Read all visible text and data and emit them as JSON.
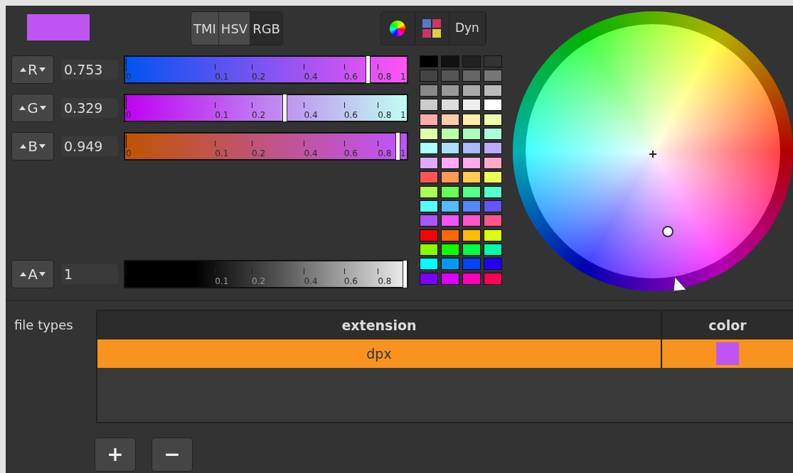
{
  "modes": [
    {
      "label": "TMI",
      "selected": false
    },
    {
      "label": "HSV",
      "selected": false
    },
    {
      "label": "RGB",
      "selected": true
    }
  ],
  "views": [
    {
      "kind": "wheel"
    },
    {
      "kind": "palette"
    },
    {
      "kind": "text",
      "label": "Dyn"
    }
  ],
  "channels": [
    {
      "kind": "color",
      "name": "R",
      "value": "0.753",
      "level": 0.868,
      "ticks": [
        "0",
        "0.1",
        "0.2",
        "0.4",
        "0.6",
        "0.8",
        "1"
      ]
    },
    {
      "kind": "color",
      "name": "G",
      "value": "0.329",
      "level": 0.574,
      "ticks": [
        "0",
        "0.1",
        "0.2",
        "0.4",
        "0.6",
        "0.8",
        "1"
      ]
    },
    {
      "kind": "color",
      "name": "B",
      "value": "0.949",
      "level": 0.974,
      "ticks": [
        "0",
        "0.1",
        "0.2",
        "0.4",
        "0.6",
        "0.8",
        "1"
      ]
    },
    {
      "kind": "alpha",
      "name": "A",
      "value": "1",
      "level": 1,
      "ticks": [
        "0.1",
        "0.2",
        "0.4",
        "0.6",
        "0.8"
      ]
    }
  ],
  "palette": [
    {
      "color": "#000000"
    },
    {
      "color": "#111111"
    },
    {
      "color": "#222222"
    },
    {
      "color": "#333333"
    },
    {
      "color": "#444444"
    },
    {
      "color": "#555555"
    },
    {
      "color": "#666666"
    },
    {
      "color": "#777777"
    },
    {
      "color": "#888888"
    },
    {
      "color": "#999999"
    },
    {
      "color": "#aaaaaa"
    },
    {
      "color": "#bbbbbb"
    },
    {
      "color": "#cccccc"
    },
    {
      "color": "#dddddd"
    },
    {
      "color": "#eeeeee"
    },
    {
      "color": "#ffffff"
    },
    {
      "color": "#ffaaaa"
    },
    {
      "color": "#ffccaa"
    },
    {
      "color": "#ffeeaa"
    },
    {
      "color": "#eeffaa"
    },
    {
      "color": "#ddffaa"
    },
    {
      "color": "#bbffaa"
    },
    {
      "color": "#aaffbb"
    },
    {
      "color": "#aaffdd"
    },
    {
      "color": "#aaffff"
    },
    {
      "color": "#aaddff"
    },
    {
      "color": "#aabbff"
    },
    {
      "color": "#bbaaff"
    },
    {
      "color": "#ddaaff"
    },
    {
      "color": "#ffaaff"
    },
    {
      "color": "#ffaaee"
    },
    {
      "color": "#ffaacc"
    },
    {
      "color": "#ff5555"
    },
    {
      "color": "#ff9955"
    },
    {
      "color": "#ffcc55"
    },
    {
      "color": "#eeff55"
    },
    {
      "color": "#aaff55"
    },
    {
      "color": "#66ff55"
    },
    {
      "color": "#55ff88"
    },
    {
      "color": "#55ffcc"
    },
    {
      "color": "#55ffff"
    },
    {
      "color": "#55bbff"
    },
    {
      "color": "#5588ff"
    },
    {
      "color": "#6655ff"
    },
    {
      "color": "#aa55ff"
    },
    {
      "color": "#ee55ff"
    },
    {
      "color": "#ff55cc"
    },
    {
      "color": "#ff5588"
    },
    {
      "color": "#ff0000"
    },
    {
      "color": "#ff6600"
    },
    {
      "color": "#ffbb00"
    },
    {
      "color": "#ddff00"
    },
    {
      "color": "#88ff00"
    },
    {
      "color": "#11ff00"
    },
    {
      "color": "#00ff44"
    },
    {
      "color": "#00ffaa"
    },
    {
      "color": "#00ffff"
    },
    {
      "color": "#0099ff"
    },
    {
      "color": "#0044ff"
    },
    {
      "color": "#2200ff"
    },
    {
      "color": "#7700ff"
    },
    {
      "color": "#dd00ff"
    },
    {
      "color": "#ff00bb"
    },
    {
      "color": "#ff0055"
    }
  ],
  "file_types": {
    "label": "file types",
    "columns": [
      "extension",
      "color"
    ],
    "rows": [
      {
        "extension": "dpx",
        "color": "#c054f2",
        "selected": true
      }
    ]
  },
  "buttons": [
    "+",
    "−"
  ]
}
